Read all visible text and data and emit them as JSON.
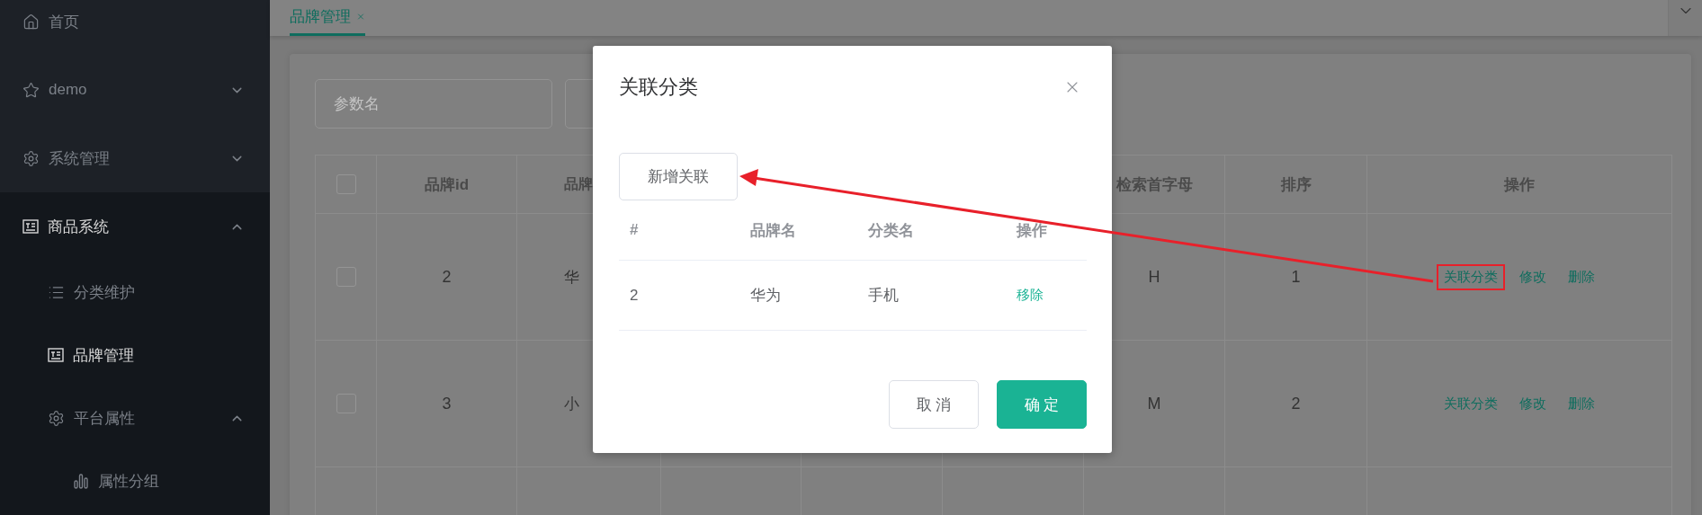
{
  "sidebar": {
    "items": [
      {
        "label": "首页"
      },
      {
        "label": "demo",
        "expanded": false
      },
      {
        "label": "系统管理",
        "expanded": false
      },
      {
        "label": "商品系统",
        "expanded": true,
        "children": [
          {
            "label": "分类维护",
            "selected": false
          },
          {
            "label": "品牌管理",
            "selected": true
          },
          {
            "label": "平台属性",
            "expanded": true,
            "children": [
              {
                "label": "属性分组",
                "selected": false
              }
            ]
          }
        ]
      }
    ]
  },
  "tabs": [
    {
      "label": "品牌管理",
      "selected": true
    }
  ],
  "filters": [
    {
      "placeholder": "参数名"
    }
  ],
  "table": {
    "header_checked": false,
    "columns": [
      "品牌id",
      "品牌",
      "检索首字母",
      "排序",
      "操作"
    ],
    "rows": [
      {
        "checked": false,
        "cells": [
          "2",
          "华",
          "H",
          "1"
        ],
        "actions": [
          {
            "label": "关联分类",
            "highlighted": true
          },
          {
            "label": "修改",
            "highlighted": false
          },
          {
            "label": "删除",
            "highlighted": false
          }
        ]
      },
      {
        "checked": false,
        "cells": [
          "3",
          "小",
          "M",
          "2"
        ],
        "actions": [
          {
            "label": "关联分类",
            "highlighted": false
          },
          {
            "label": "修改",
            "highlighted": false
          },
          {
            "label": "删除",
            "highlighted": false
          }
        ]
      }
    ]
  },
  "dialog": {
    "title": "关联分类",
    "add_button": "新增关联",
    "columns": [
      "#",
      "品牌名",
      "分类名",
      "操作"
    ],
    "rows": [
      {
        "cells": [
          "2",
          "华为",
          "手机"
        ],
        "action": "移除"
      }
    ],
    "buttons": [
      {
        "label": "取 消",
        "kind": "default"
      },
      {
        "label": "确 定",
        "kind": "primary"
      }
    ]
  }
}
